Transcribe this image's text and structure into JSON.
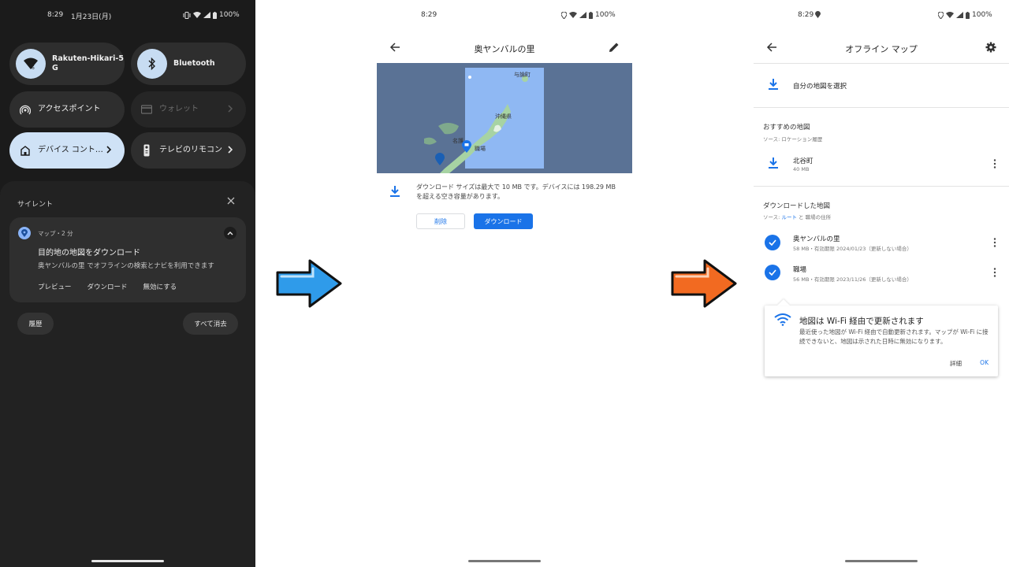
{
  "panel1": {
    "status": {
      "time": "8:29",
      "date": "1月23日(月)",
      "battery": "100%"
    },
    "tiles": [
      {
        "label": "Rakuten-Hikari-5\nG",
        "icon": "wifi-icon"
      },
      {
        "label": "Bluetooth",
        "icon": "bluetooth-icon"
      },
      {
        "label": "アクセスポイント",
        "icon": "hotspot-icon"
      },
      {
        "label": "ウォレット",
        "icon": "wallet-icon"
      },
      {
        "label": "デバイス コント…",
        "icon": "home-icon"
      },
      {
        "label": "テレビのリモコン",
        "icon": "remote-icon"
      }
    ],
    "section_label": "サイレント",
    "notification": {
      "meta": "マップ・2 分",
      "title": "目的地の地図をダウンロード",
      "body": "奥ヤンバルの里 でオフラインの検索とナビを利用できます",
      "actions": [
        "プレビュー",
        "ダウンロード",
        "無効にする"
      ]
    },
    "history_label": "履歴",
    "clear_all_label": "すべて消去"
  },
  "panel2": {
    "status": {
      "time": "8:29",
      "battery": "100%"
    },
    "title": "奥ヤンバルの里",
    "map_labels": {
      "north": "与論町",
      "okinawa": "沖縄県",
      "pin": "職場",
      "south": "名護"
    },
    "download_text": "ダウンロード サイズは最大で 10 MB です。デバイスには 198.29 MB を超える空き容量があります。",
    "delete_label": "削除",
    "download_label": "ダウンロード"
  },
  "panel3": {
    "status": {
      "time": "8:29",
      "battery": "100%"
    },
    "title": "オフライン マップ",
    "select_own_map": "自分の地図を選択",
    "recommended_header": "おすすめの地図",
    "recommended_source": "ソース: ロケーション履歴",
    "recommended_item": {
      "name": "北谷町",
      "size": "40 MB"
    },
    "downloaded_header": "ダウンロードした地図",
    "downloaded_source_prefix": "ソース: ",
    "downloaded_source_link": "ルート",
    "downloaded_source_suffix": " と 職場の住所",
    "downloaded_items": [
      {
        "name": "奥ヤンバルの里",
        "detail": "58 MB・有効期限 2024/01/23（更新しない場合）"
      },
      {
        "name": "職場",
        "detail": "56 MB・有効期限 2023/11/26（更新しない場合）"
      }
    ],
    "tip": {
      "title": "地図は Wi-Fi 経由で更新されます",
      "body": "最近使った地図が Wi-Fi 経由で自動更新されます。マップが Wi-Fi に接続できないと、地図は示された日時に無効になります。",
      "detail_label": "詳細",
      "ok_label": "OK"
    }
  },
  "colors": {
    "accent_blue": "#1a73e8",
    "arrow_blue": "#2f9bea",
    "arrow_orange": "#f26a21",
    "dark_bg": "#1b1b1b",
    "map_sea": "#5a7295",
    "map_selection": "#8fb8f3"
  }
}
